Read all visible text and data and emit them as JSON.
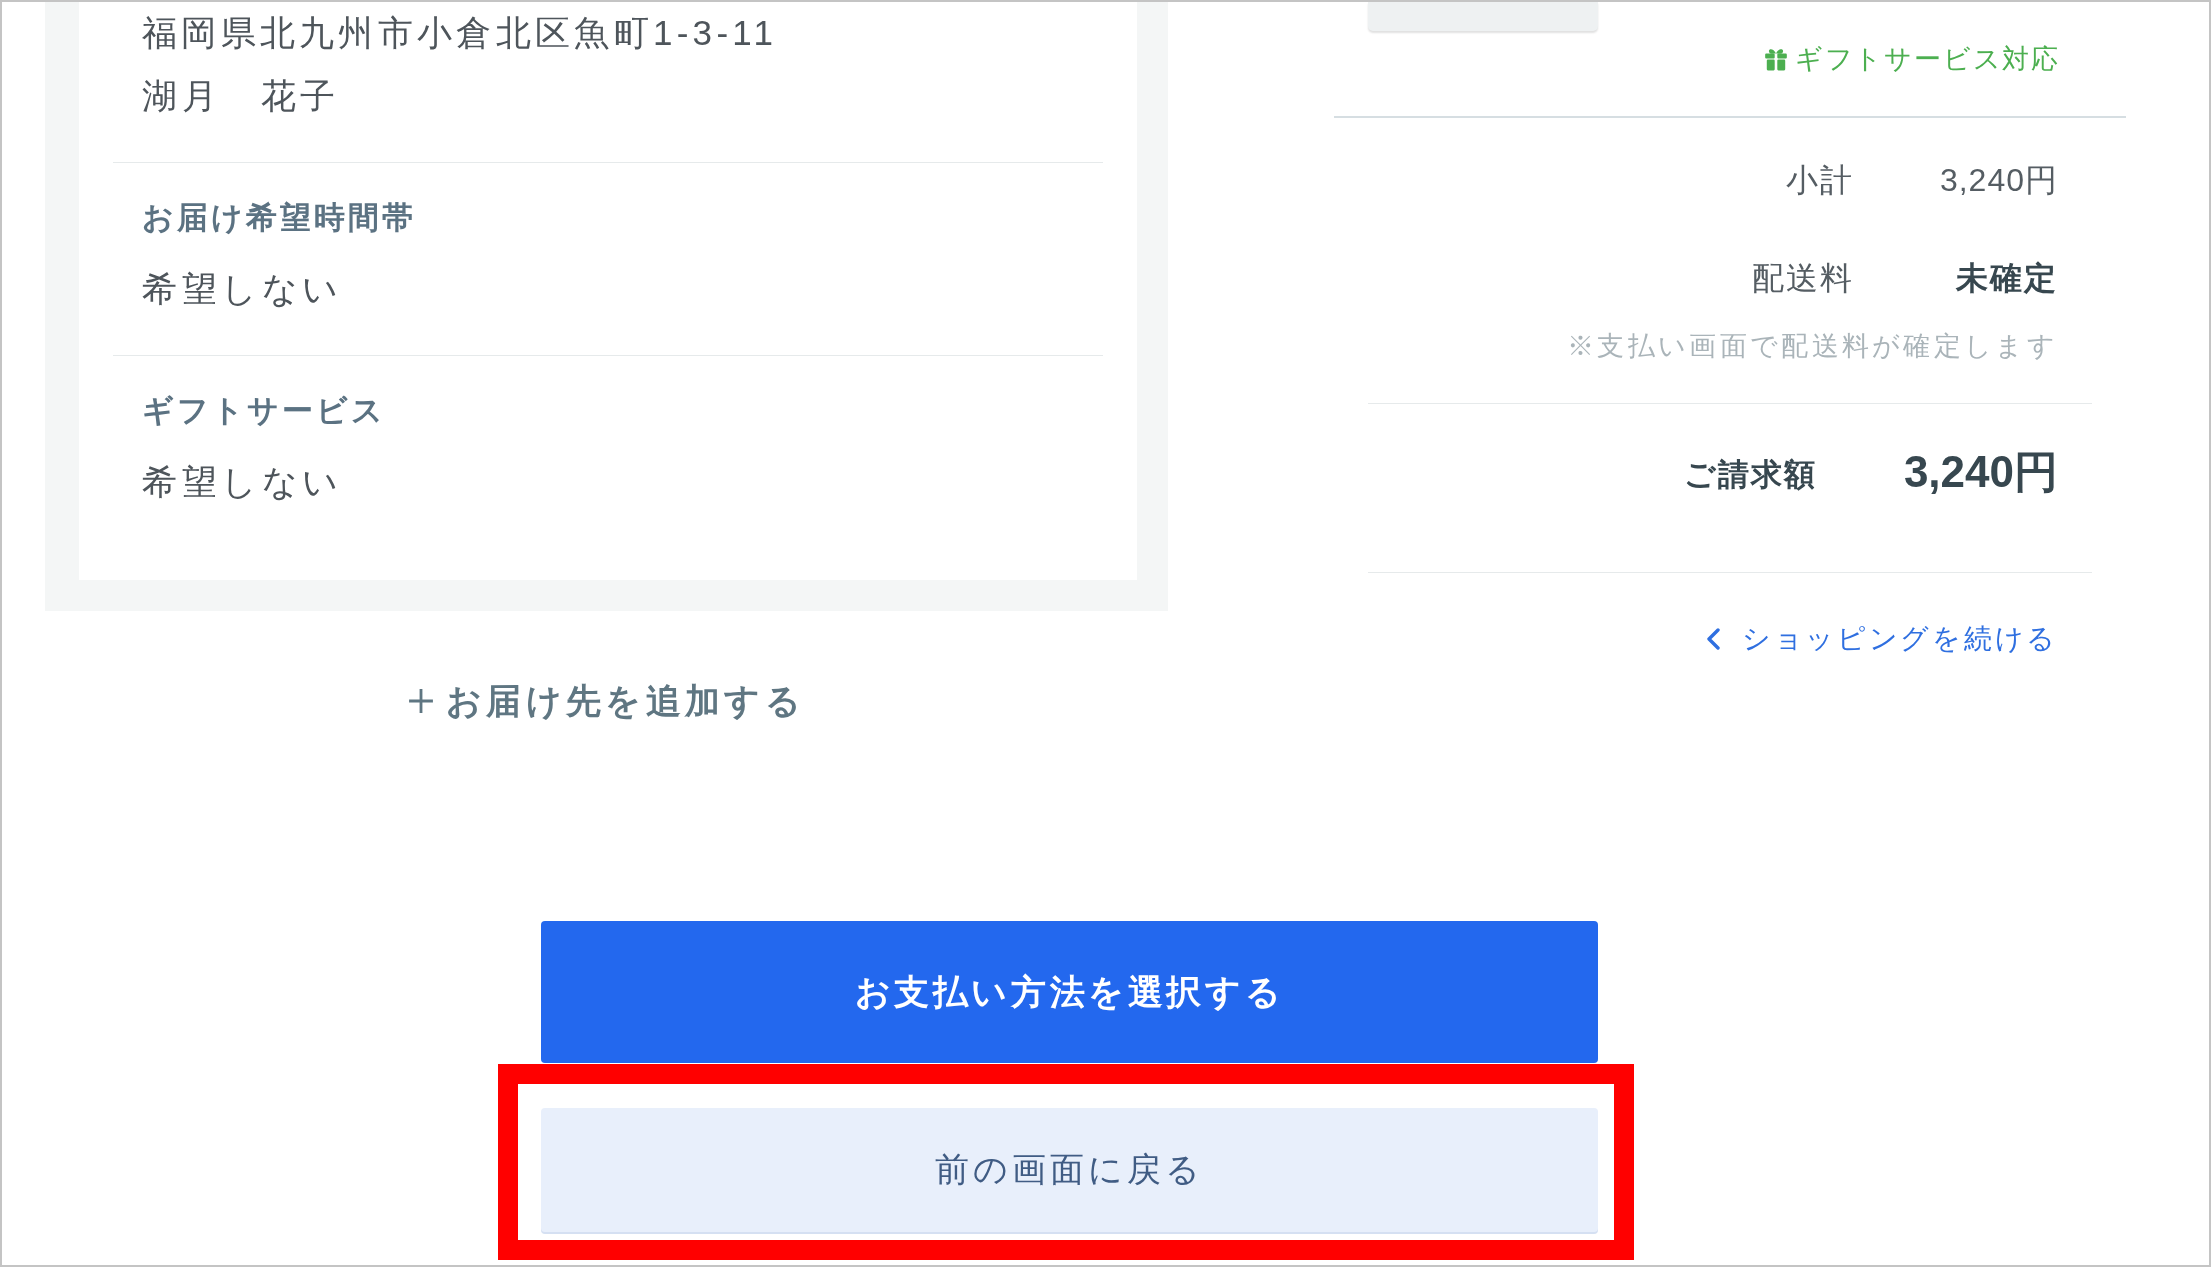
{
  "delivery": {
    "address": "福岡県北九州市小倉北区魚町1-3-11",
    "recipient": "湖月　花子",
    "fields": [
      {
        "label": "お届け希望時間帯",
        "value": "希望しない"
      },
      {
        "label": "ギフトサービス",
        "value": "希望しない"
      }
    ],
    "add_destination_link": "お届け先を追加する"
  },
  "gift_badge": "ギフトサービス対応",
  "summary": {
    "rows": [
      {
        "label": "小計",
        "value": "3,240円",
        "emphasis": false
      },
      {
        "label": "配送料",
        "value": "未確定",
        "emphasis": true
      }
    ],
    "note": "※支払い画面で配送料が確定します",
    "total": {
      "label": "ご請求額",
      "value": "3,240円"
    }
  },
  "continue_shopping_link": "ショッピングを続ける",
  "buttons": [
    {
      "label": "お支払い方法を選択する",
      "kind": "primary",
      "highlighted": false
    },
    {
      "label": "前の画面に戻る",
      "kind": "secondary",
      "highlighted": true
    }
  ]
}
